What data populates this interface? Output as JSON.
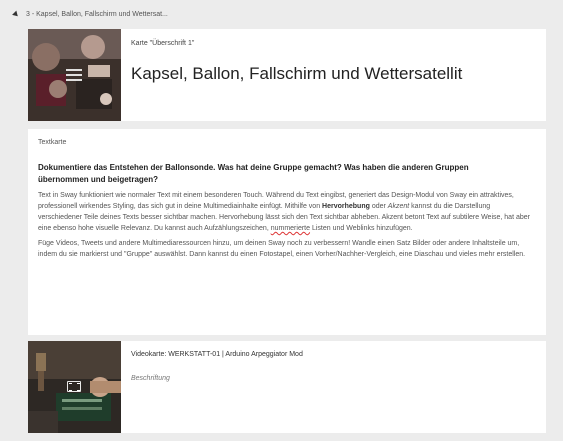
{
  "section": {
    "title": "3 - Kapsel, Ballon, Fallschirm und Wettersat..."
  },
  "heading_card": {
    "type_label": "Karte \"Überschrift 1\"",
    "title": "Kapsel, Ballon, Fallschirm und Wettersatellit"
  },
  "text_card": {
    "label": "Textkarte",
    "heading": "Dokumentiere das Entstehen der Ballonsonde. Was hat deine Gruppe gemacht? Was haben die anderen Gruppen übernommen und beigetragen?",
    "p1_a": "Text in Sway funktioniert wie normaler Text mit einem besonderen Touch. Während du Text eingibst, generiert das Design-Modul von Sway ein attraktives, professionell wirkendes Styling, das sich gut in deine Multimediainhalte einfügt. Mithilfe von ",
    "p1_bold": "Hervorhebung",
    "p1_b": " oder ",
    "p1_italic": "Akzent",
    "p1_c": " kannst du die Darstellung verschiedener Teile deines Texts besser sichtbar machen. Hervorhebung lässt sich den Text sichtbar abheben. Akzent betont Text auf subtilere Weise, hat aber eine ebenso hohe visuelle Relevanz. Du kannst auch Aufzählungszeichen, ",
    "p1_squiggle": "nummerierte",
    "p1_d": " Listen und Weblinks hinzufügen.",
    "p2": "Füge Videos, Tweets und andere Multimediaressourcen hinzu, um deinen Sway noch zu verbessern! Wandle einen Satz Bilder oder andere Inhaltsteile um, indem du sie markierst und \"Gruppe\" auswählst. Dann kannst du einen Fotostapel, einen Vorher/Nachher-Vergleich, eine Diaschau und vieles mehr erstellen."
  },
  "video_card": {
    "label": "Videokarte: WERKSTATT-01 | Arduino Arpeggiator Mod",
    "caption_placeholder": "Beschriftung"
  },
  "icons": {
    "collapse": "chevron-down-icon",
    "heading_thumb": "heading-card-icon",
    "video_thumb": "film-icon"
  }
}
